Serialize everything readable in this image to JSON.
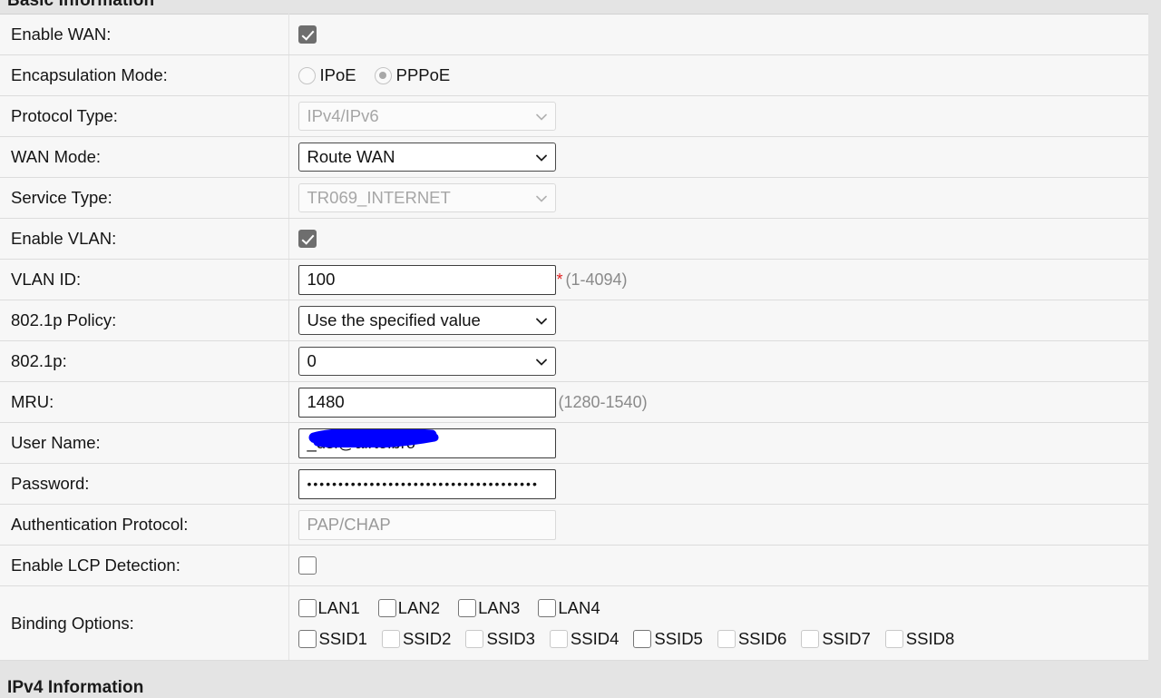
{
  "sections": {
    "basic_information": "Basic Information",
    "ipv4_information": "IPv4 Information"
  },
  "colors": {
    "redaction": "#0000ff",
    "required_star": "#e02020",
    "hint_text": "#8a8a8a",
    "row_background": "#f7f7f7",
    "page_background": "#e4e4e4"
  },
  "rows": {
    "enable_wan": {
      "label": "Enable WAN:",
      "checked": true,
      "state": "checked-disabled"
    },
    "encapsulation_mode": {
      "label": "Encapsulation Mode:",
      "options": [
        {
          "label": "IPoE",
          "selected": false
        },
        {
          "label": "PPPoE",
          "selected": true
        }
      ]
    },
    "protocol_type": {
      "label": "Protocol Type:",
      "value": "IPv4/IPv6",
      "enabled": false
    },
    "wan_mode": {
      "label": "WAN Mode:",
      "value": "Route WAN",
      "enabled": true
    },
    "service_type": {
      "label": "Service Type:",
      "value": "TR069_INTERNET",
      "enabled": false
    },
    "enable_vlan": {
      "label": "Enable VLAN:",
      "checked": true,
      "state": "checked-disabled"
    },
    "vlan_id": {
      "label": "VLAN ID:",
      "value": "100",
      "required_mark": "*",
      "hint": "(1-4094)"
    },
    "dot1p_policy": {
      "label": "802.1p Policy:",
      "value": "Use the specified value",
      "enabled": true
    },
    "dot1p": {
      "label": "802.1p:",
      "value": "0",
      "enabled": true
    },
    "mru": {
      "label": "MRU:",
      "value": "1480",
      "hint": "(1280-1540)"
    },
    "user_name": {
      "label": "User Name:",
      "value": "_dsl@airtelbro",
      "redacted": true
    },
    "password": {
      "label": "Password:",
      "value": "•••••••••••••••••••••••••••••••••••••"
    },
    "authentication_protocol": {
      "label": "Authentication Protocol:",
      "value": "PAP/CHAP",
      "enabled": false
    },
    "enable_lcp_detection": {
      "label": "Enable LCP Detection:",
      "checked": false,
      "state": "unchecked"
    },
    "binding_options": {
      "label": "Binding Options:",
      "lan": [
        {
          "label": "LAN1",
          "checked": false,
          "enabled": true
        },
        {
          "label": "LAN2",
          "checked": false,
          "enabled": true
        },
        {
          "label": "LAN3",
          "checked": false,
          "enabled": true
        },
        {
          "label": "LAN4",
          "checked": false,
          "enabled": true
        }
      ],
      "ssid": [
        {
          "label": "SSID1",
          "checked": false,
          "enabled": true
        },
        {
          "label": "SSID2",
          "checked": false,
          "enabled": false
        },
        {
          "label": "SSID3",
          "checked": false,
          "enabled": false
        },
        {
          "label": "SSID4",
          "checked": false,
          "enabled": false
        },
        {
          "label": "SSID5",
          "checked": false,
          "enabled": true
        },
        {
          "label": "SSID6",
          "checked": false,
          "enabled": false
        },
        {
          "label": "SSID7",
          "checked": false,
          "enabled": false
        },
        {
          "label": "SSID8",
          "checked": false,
          "enabled": false
        }
      ]
    }
  }
}
